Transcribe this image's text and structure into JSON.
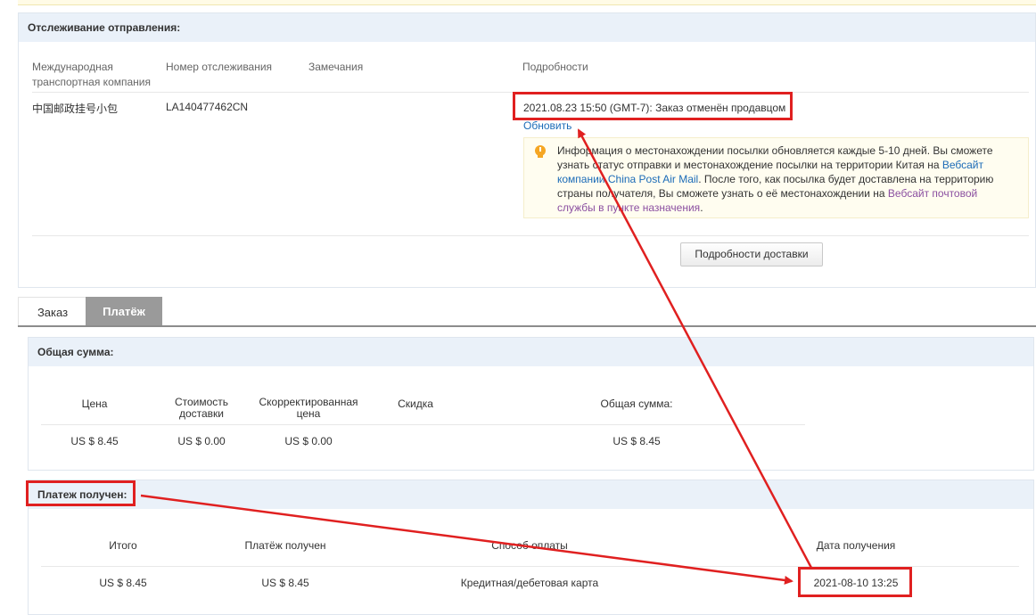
{
  "tracking": {
    "title": "Отслеживание отправления:",
    "headers": {
      "carrier_line1": "Международная",
      "carrier_line2": "транспортная компания",
      "tracking_number": "Номер отслеживания",
      "remarks": "Замечания",
      "details": "Подробности"
    },
    "row": {
      "carrier": "中国邮政挂号小包",
      "tracking_number": "LA140477462CN",
      "status": "2021.08.23 15:50 (GMT-7): Заказ отменён продавцом",
      "refresh_link": "Обновить"
    },
    "notice": {
      "part1": "Информация о местонахождении посылки обновляется каждые 5-10 дней. Вы сможете узнать статус отправки и местонахождение посылки на территории Китая на ",
      "link1": "Вебсайт компании China Post Air Mail",
      "part2": ". После того, как посылка будет доставлена на территорию страны получателя, Вы сможете узнать о её местонахождении на ",
      "link2": "Вебсайт почтовой службы в пункте назначения",
      "part3": "."
    },
    "delivery_button": "Подробности доставки"
  },
  "tabs": [
    {
      "label": "Заказ",
      "active": false
    },
    {
      "label": "Платёж",
      "active": true
    }
  ],
  "total": {
    "title": "Общая сумма:",
    "headers": {
      "price": "Цена",
      "shipping_line1": "Стоимость",
      "shipping_line2": "доставки",
      "adjusted_line1": "Скорректированная",
      "adjusted_line2": "цена",
      "discount": "Скидка",
      "total": "Общая сумма:"
    },
    "values": {
      "price": "US $ 8.45",
      "shipping": "US $ 0.00",
      "adjusted": "US $ 0.00",
      "discount": "",
      "total": "US $ 8.45"
    }
  },
  "payment": {
    "title": "Платеж получен:",
    "headers": {
      "subtotal": "Итого",
      "received": "Платёж получен",
      "method": "Способ оплаты",
      "date": "Дата получения"
    },
    "values": {
      "subtotal": "US $ 8.45",
      "received": "US $ 8.45",
      "method": "Кредитная/дебетовая карта",
      "date": "2021-08-10 13:25"
    }
  },
  "colors": {
    "annotation": "#e02020",
    "header_bg": "#eaf1f9",
    "link": "#1b6bb7"
  }
}
